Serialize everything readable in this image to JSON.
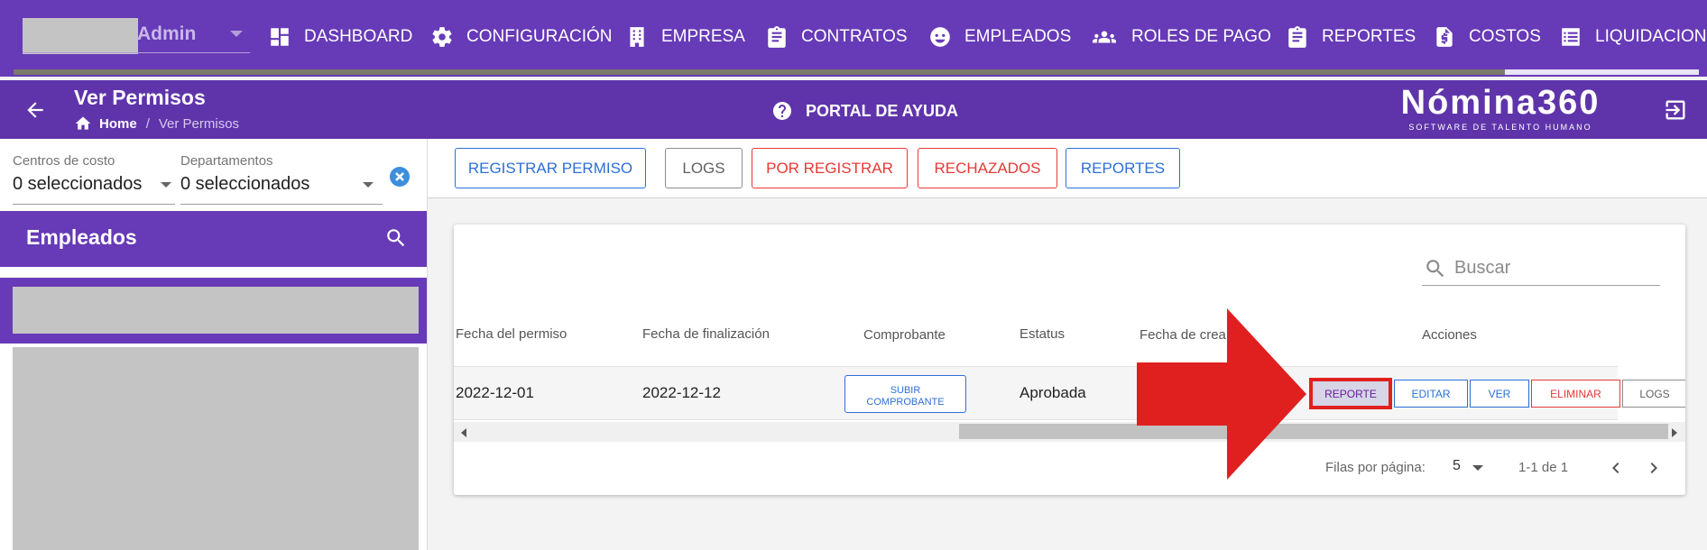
{
  "user": {
    "name": "Admin"
  },
  "nav": [
    {
      "label": "DASHBOARD",
      "icon": "dashboard-icon"
    },
    {
      "label": "CONFIGURACIÓN",
      "icon": "gear-icon"
    },
    {
      "label": "EMPRESA",
      "icon": "building-icon"
    },
    {
      "label": "CONTRATOS",
      "icon": "clipboard-icon"
    },
    {
      "label": "EMPLEADOS",
      "icon": "face-icon"
    },
    {
      "label": "ROLES DE PAGO",
      "icon": "group-icon"
    },
    {
      "label": "REPORTES",
      "icon": "clipboard-icon"
    },
    {
      "label": "COSTOS",
      "icon": "invoice-icon"
    },
    {
      "label": "LIQUIDACIONES",
      "icon": "list-icon"
    }
  ],
  "header": {
    "title": "Ver Permisos",
    "breadcrumb": {
      "home": "Home",
      "sep": "/",
      "current": "Ver Permisos"
    },
    "help": "PORTAL DE AYUDA",
    "brand": "Nómina360",
    "brand_tagline": "SOFTWARE DE TALENTO HUMANO"
  },
  "filters": {
    "centros": {
      "label": "Centros de costo",
      "value": "0 seleccionados"
    },
    "departamentos": {
      "label": "Departamentos",
      "value": "0 seleccionados"
    }
  },
  "sidebar": {
    "title": "Empleados"
  },
  "actions": {
    "registrar": "REGISTRAR PERMISO",
    "logs": "LOGS",
    "por_registrar": "POR REGISTRAR",
    "rechazados": "RECHAZADOS",
    "reportes": "REPORTES"
  },
  "table": {
    "search_placeholder": "Buscar",
    "headers": {
      "fecha_permiso": "Fecha del permiso",
      "fecha_fin": "Fecha de finalización",
      "comprobante": "Comprobante",
      "estatus": "Estatus",
      "fecha_creacion": "Fecha de crea",
      "acciones": "Acciones"
    },
    "row": {
      "fecha_permiso": "2022-12-01",
      "fecha_fin": "2022-12-12",
      "subir_line1": "SUBIR",
      "subir_line2": "COMPROBANTE",
      "estatus": "Aprobada",
      "btn_reporte": "REPORTE",
      "btn_editar": "EDITAR",
      "btn_ver": "VER",
      "btn_eliminar": "ELIMINAR",
      "btn_logs": "LOGS"
    },
    "pager": {
      "label": "Filas por página:",
      "rows": "5",
      "range": "1-1 de 1"
    }
  },
  "colors": {
    "primary": "#673ab7",
    "titlebar": "#5f34aa",
    "accent_blue": "#2c6fd6",
    "danger": "#e53935",
    "highlight_arrow": "#e0201f"
  }
}
